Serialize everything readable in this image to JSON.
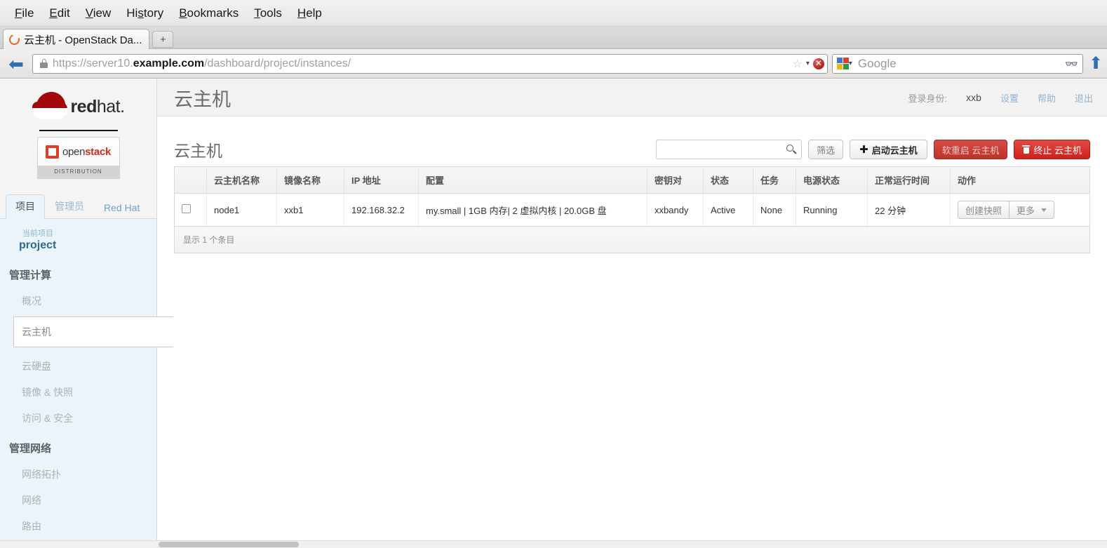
{
  "browser": {
    "menus": [
      {
        "accel": "F",
        "rest": "ile"
      },
      {
        "accel": "E",
        "rest": "dit"
      },
      {
        "accel": "V",
        "rest": "iew"
      },
      {
        "pre": "Hi",
        "accel": "s",
        "rest": "tory"
      },
      {
        "accel": "B",
        "rest": "ookmarks"
      },
      {
        "accel": "T",
        "rest": "ools"
      },
      {
        "accel": "H",
        "rest": "elp"
      }
    ],
    "tab_title": "云主机 - OpenStack Da...",
    "newtab_label": "+",
    "url_scheme": "https://server10.",
    "url_domain": "example.com",
    "url_path": "/dashboard/project/instances/",
    "search_placeholder": "Google",
    "search_engine": "Google"
  },
  "sidebar": {
    "brand_red": "red",
    "brand_hat": "hat.",
    "openstack_open": "open",
    "openstack_stack": "stack",
    "openstack_sub": "DISTRIBUTION",
    "tabs": [
      {
        "label": "项目",
        "active": true
      },
      {
        "label": "管理员",
        "active": false
      },
      {
        "label": "Red Hat",
        "active": false
      }
    ],
    "current_project_label": "当前项目",
    "current_project_name": "project",
    "groups": [
      {
        "title": "管理计算",
        "items": [
          {
            "label": "概况",
            "active": false
          },
          {
            "label": "云主机",
            "active": true
          },
          {
            "label": "云硬盘",
            "active": false
          },
          {
            "label": "镜像 & 快照",
            "active": false
          },
          {
            "label": "访问 & 安全",
            "active": false
          }
        ]
      },
      {
        "title": "管理网络",
        "items": [
          {
            "label": "网络拓扑",
            "active": false
          },
          {
            "label": "网络",
            "active": false
          },
          {
            "label": "路由",
            "active": false
          }
        ]
      }
    ]
  },
  "header": {
    "title": "云主机",
    "logged_in_label": "登录身份:",
    "username": "xxb",
    "links": [
      "设置",
      "帮助",
      "退出"
    ]
  },
  "panel": {
    "title": "云主机",
    "search_value": "",
    "search_placeholder": "",
    "buttons": {
      "filter": "筛选",
      "launch": "启动云主机",
      "soft_reboot": "软重启 云主机",
      "terminate": "终止 云主机"
    }
  },
  "table": {
    "columns": [
      "",
      "云主机名称",
      "镜像名称",
      "IP 地址",
      "配置",
      "密钥对",
      "状态",
      "任务",
      "电源状态",
      "正常运行时间",
      "动作"
    ],
    "rows": [
      {
        "name": "node1",
        "image": "xxb1",
        "ip": "192.168.32.2",
        "flavor": "my.small | 1GB 内存| 2 虚拟内核 | 20.0GB 盘",
        "keypair": "xxbandy",
        "status": "Active",
        "task": "None",
        "power": "Running",
        "uptime": "22 分钟",
        "actions": {
          "primary": "创建快照",
          "more": "更多"
        }
      }
    ],
    "footer": "显示 1 个条目"
  },
  "colors": {
    "accent_blue": "#4aa3df",
    "danger_red": "#cf211a",
    "redhat_red": "#a3080c",
    "nav_bg": "#eaf4fa"
  }
}
